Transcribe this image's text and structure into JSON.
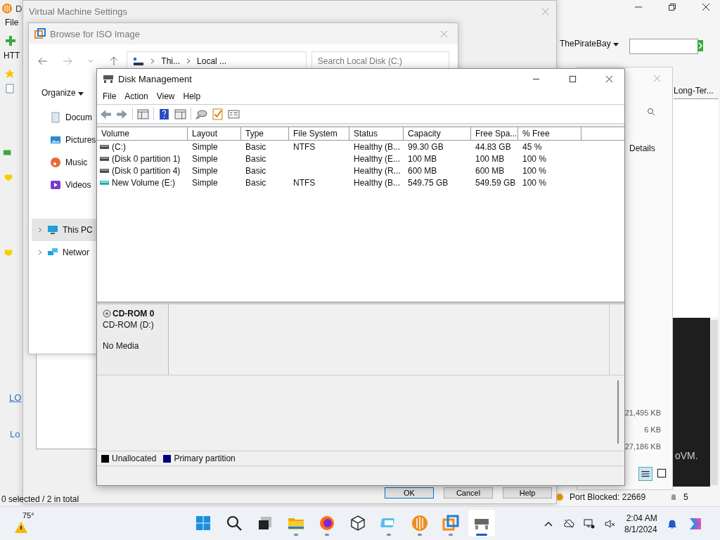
{
  "left_app": {
    "title": "D",
    "menu": [
      "File"
    ],
    "toolbar_label": "HTT",
    "links": [
      "LO",
      "Lo"
    ],
    "status": "0 selected / 2 in total"
  },
  "right_app": {
    "site_menu": "ThePirateBay",
    "column_header": "Long-Ter...",
    "sizes": [
      "21,495 KB",
      "6 KB",
      "27,186 KB"
    ],
    "banner_text": "oVM.",
    "port_status": "Port Blocked: 22669",
    "count": "5"
  },
  "side_panel": {
    "label": "Details"
  },
  "vm_settings": {
    "title": "Virtual Machine Settings",
    "buttons": [
      "OK",
      "Cancel",
      "Help"
    ]
  },
  "browse": {
    "title": "Browse for ISO Image",
    "breadcrumb": [
      "Thi...",
      "Local ..."
    ],
    "search": {
      "placeholder": "Search Local Disk (C:)"
    },
    "organize": "Organize",
    "nav": [
      {
        "label": "Docum",
        "kind": "documents",
        "selected": false
      },
      {
        "label": "Pictures",
        "kind": "pictures",
        "selected": false
      },
      {
        "label": "Music",
        "kind": "music",
        "selected": false
      },
      {
        "label": "Videos",
        "kind": "videos",
        "selected": false
      },
      {
        "label": "This PC",
        "kind": "pc",
        "selected": true
      },
      {
        "label": "Networ",
        "kind": "network",
        "selected": false
      }
    ]
  },
  "disk_management": {
    "title": "Disk Management",
    "menu": [
      "File",
      "Action",
      "View",
      "Help"
    ],
    "columns": [
      "Volume",
      "Layout",
      "Type",
      "File System",
      "Status",
      "Capacity",
      "Free Spa...",
      "% Free"
    ],
    "volumes": [
      {
        "kind": "system",
        "cells": [
          "(C:)",
          "Simple",
          "Basic",
          "NTFS",
          "Healthy (B...",
          "99.30 GB",
          "44.83 GB",
          "45 %"
        ]
      },
      {
        "kind": "system",
        "cells": [
          "(Disk 0 partition 1)",
          "Simple",
          "Basic",
          "",
          "Healthy (E...",
          "100 MB",
          "100 MB",
          "100 %"
        ]
      },
      {
        "kind": "system",
        "cells": [
          "(Disk 0 partition 4)",
          "Simple",
          "Basic",
          "",
          "Healthy (R...",
          "600 MB",
          "600 MB",
          "100 %"
        ]
      },
      {
        "kind": "data",
        "cells": [
          "New Volume (E:)",
          "Simple",
          "Basic",
          "NTFS",
          "Healthy (B...",
          "549.75 GB",
          "549.59 GB",
          "100 %"
        ]
      }
    ],
    "disks": [
      {
        "name": "CD-ROM 0",
        "drive": "CD-ROM (D:)",
        "media": "No Media"
      }
    ],
    "legend": [
      {
        "label": "Unallocated",
        "color": "#000000"
      },
      {
        "label": "Primary partition",
        "color": "#000080"
      }
    ]
  },
  "taskbar": {
    "weather": "75°",
    "apps": [
      {
        "kind": "start",
        "running": false,
        "selected": false
      },
      {
        "kind": "search",
        "running": false,
        "selected": false
      },
      {
        "kind": "taskview",
        "running": false,
        "selected": false
      },
      {
        "kind": "folder",
        "running": true,
        "selected": false
      },
      {
        "kind": "browser",
        "running": true,
        "selected": false
      },
      {
        "kind": "cube",
        "running": false,
        "selected": false
      },
      {
        "kind": "remote",
        "running": true,
        "selected": false
      },
      {
        "kind": "torrent",
        "running": true,
        "selected": false
      },
      {
        "kind": "vm",
        "running": true,
        "selected": false
      },
      {
        "kind": "diskmgmt",
        "running": true,
        "selected": true
      }
    ],
    "time": "2:04 AM",
    "date": "8/1/2024"
  }
}
